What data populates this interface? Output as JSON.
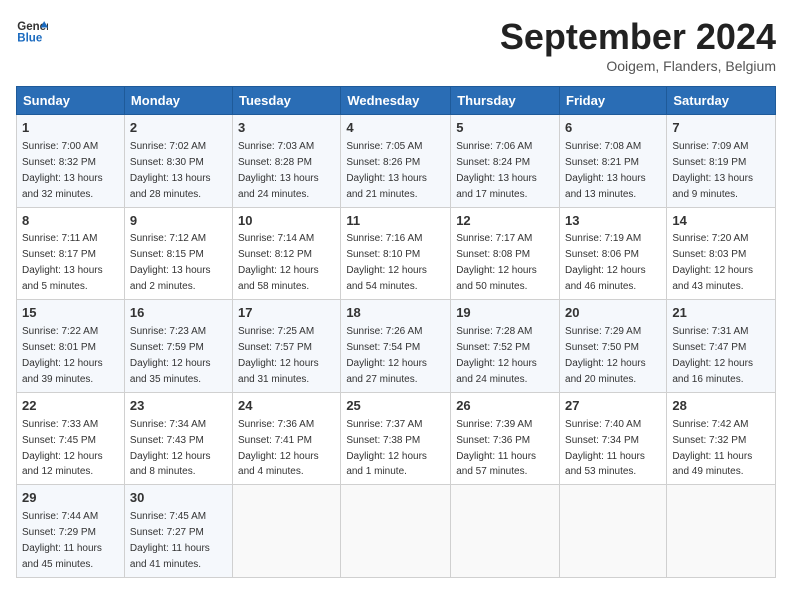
{
  "header": {
    "logo_line1": "General",
    "logo_line2": "Blue",
    "month": "September 2024",
    "location": "Ooigem, Flanders, Belgium"
  },
  "columns": [
    "Sunday",
    "Monday",
    "Tuesday",
    "Wednesday",
    "Thursday",
    "Friday",
    "Saturday"
  ],
  "weeks": [
    [
      {
        "day": "1",
        "detail": "Sunrise: 7:00 AM\nSunset: 8:32 PM\nDaylight: 13 hours\nand 32 minutes."
      },
      {
        "day": "2",
        "detail": "Sunrise: 7:02 AM\nSunset: 8:30 PM\nDaylight: 13 hours\nand 28 minutes."
      },
      {
        "day": "3",
        "detail": "Sunrise: 7:03 AM\nSunset: 8:28 PM\nDaylight: 13 hours\nand 24 minutes."
      },
      {
        "day": "4",
        "detail": "Sunrise: 7:05 AM\nSunset: 8:26 PM\nDaylight: 13 hours\nand 21 minutes."
      },
      {
        "day": "5",
        "detail": "Sunrise: 7:06 AM\nSunset: 8:24 PM\nDaylight: 13 hours\nand 17 minutes."
      },
      {
        "day": "6",
        "detail": "Sunrise: 7:08 AM\nSunset: 8:21 PM\nDaylight: 13 hours\nand 13 minutes."
      },
      {
        "day": "7",
        "detail": "Sunrise: 7:09 AM\nSunset: 8:19 PM\nDaylight: 13 hours\nand 9 minutes."
      }
    ],
    [
      {
        "day": "8",
        "detail": "Sunrise: 7:11 AM\nSunset: 8:17 PM\nDaylight: 13 hours\nand 5 minutes."
      },
      {
        "day": "9",
        "detail": "Sunrise: 7:12 AM\nSunset: 8:15 PM\nDaylight: 13 hours\nand 2 minutes."
      },
      {
        "day": "10",
        "detail": "Sunrise: 7:14 AM\nSunset: 8:12 PM\nDaylight: 12 hours\nand 58 minutes."
      },
      {
        "day": "11",
        "detail": "Sunrise: 7:16 AM\nSunset: 8:10 PM\nDaylight: 12 hours\nand 54 minutes."
      },
      {
        "day": "12",
        "detail": "Sunrise: 7:17 AM\nSunset: 8:08 PM\nDaylight: 12 hours\nand 50 minutes."
      },
      {
        "day": "13",
        "detail": "Sunrise: 7:19 AM\nSunset: 8:06 PM\nDaylight: 12 hours\nand 46 minutes."
      },
      {
        "day": "14",
        "detail": "Sunrise: 7:20 AM\nSunset: 8:03 PM\nDaylight: 12 hours\nand 43 minutes."
      }
    ],
    [
      {
        "day": "15",
        "detail": "Sunrise: 7:22 AM\nSunset: 8:01 PM\nDaylight: 12 hours\nand 39 minutes."
      },
      {
        "day": "16",
        "detail": "Sunrise: 7:23 AM\nSunset: 7:59 PM\nDaylight: 12 hours\nand 35 minutes."
      },
      {
        "day": "17",
        "detail": "Sunrise: 7:25 AM\nSunset: 7:57 PM\nDaylight: 12 hours\nand 31 minutes."
      },
      {
        "day": "18",
        "detail": "Sunrise: 7:26 AM\nSunset: 7:54 PM\nDaylight: 12 hours\nand 27 minutes."
      },
      {
        "day": "19",
        "detail": "Sunrise: 7:28 AM\nSunset: 7:52 PM\nDaylight: 12 hours\nand 24 minutes."
      },
      {
        "day": "20",
        "detail": "Sunrise: 7:29 AM\nSunset: 7:50 PM\nDaylight: 12 hours\nand 20 minutes."
      },
      {
        "day": "21",
        "detail": "Sunrise: 7:31 AM\nSunset: 7:47 PM\nDaylight: 12 hours\nand 16 minutes."
      }
    ],
    [
      {
        "day": "22",
        "detail": "Sunrise: 7:33 AM\nSunset: 7:45 PM\nDaylight: 12 hours\nand 12 minutes."
      },
      {
        "day": "23",
        "detail": "Sunrise: 7:34 AM\nSunset: 7:43 PM\nDaylight: 12 hours\nand 8 minutes."
      },
      {
        "day": "24",
        "detail": "Sunrise: 7:36 AM\nSunset: 7:41 PM\nDaylight: 12 hours\nand 4 minutes."
      },
      {
        "day": "25",
        "detail": "Sunrise: 7:37 AM\nSunset: 7:38 PM\nDaylight: 12 hours\nand 1 minute."
      },
      {
        "day": "26",
        "detail": "Sunrise: 7:39 AM\nSunset: 7:36 PM\nDaylight: 11 hours\nand 57 minutes."
      },
      {
        "day": "27",
        "detail": "Sunrise: 7:40 AM\nSunset: 7:34 PM\nDaylight: 11 hours\nand 53 minutes."
      },
      {
        "day": "28",
        "detail": "Sunrise: 7:42 AM\nSunset: 7:32 PM\nDaylight: 11 hours\nand 49 minutes."
      }
    ],
    [
      {
        "day": "29",
        "detail": "Sunrise: 7:44 AM\nSunset: 7:29 PM\nDaylight: 11 hours\nand 45 minutes."
      },
      {
        "day": "30",
        "detail": "Sunrise: 7:45 AM\nSunset: 7:27 PM\nDaylight: 11 hours\nand 41 minutes."
      },
      {
        "day": "",
        "detail": ""
      },
      {
        "day": "",
        "detail": ""
      },
      {
        "day": "",
        "detail": ""
      },
      {
        "day": "",
        "detail": ""
      },
      {
        "day": "",
        "detail": ""
      }
    ]
  ]
}
